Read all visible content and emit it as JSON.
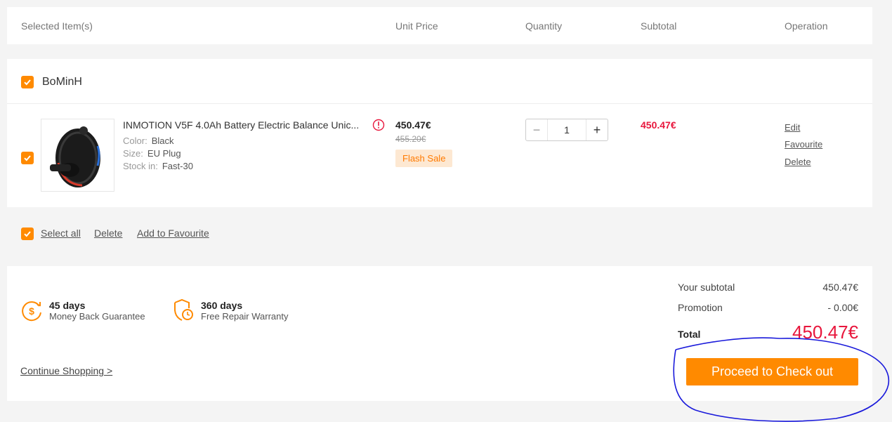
{
  "header": {
    "selected_items": "Selected Item(s)",
    "unit_price": "Unit Price",
    "quantity": "Quantity",
    "subtotal": "Subtotal",
    "operation": "Operation"
  },
  "store": {
    "name": "BoMinH",
    "checked": true
  },
  "item": {
    "checked": true,
    "name": "INMOTION V5F 4.0Ah Battery Electric Balance Unic...",
    "color_label": "Color:",
    "color_value": "Black",
    "size_label": "Size:",
    "size_value": "EU Plug",
    "stock_label": "Stock in:",
    "stock_value": "Fast-30",
    "price": "450.47€",
    "original_price": "455.20€",
    "badge": "Flash Sale",
    "quantity": "1",
    "subtotal": "450.47€",
    "operations": {
      "edit": "Edit",
      "favourite": "Favourite",
      "delete": "Delete"
    }
  },
  "bulk": {
    "select_all": "Select all",
    "delete": "Delete",
    "add_to_favourite": "Add to Favourite"
  },
  "guarantees": [
    {
      "title": "45 days",
      "subtitle": "Money Back Guarantee",
      "icon": "money-back-icon"
    },
    {
      "title": "360 days",
      "subtitle": "Free Repair Warranty",
      "icon": "warranty-shield-icon"
    }
  ],
  "summary": {
    "subtotal_label": "Your subtotal",
    "subtotal_value": "450.47€",
    "promotion_label": "Promotion",
    "promotion_value": "- 0.00€",
    "total_label": "Total",
    "total_value": "450.47€",
    "checkout_label": "Proceed to Check out"
  },
  "continue_shopping": "Continue Shopping >",
  "colors": {
    "accent": "#ff8a00",
    "price_red": "#e8173d",
    "annotation_blue": "#1a1adb"
  }
}
